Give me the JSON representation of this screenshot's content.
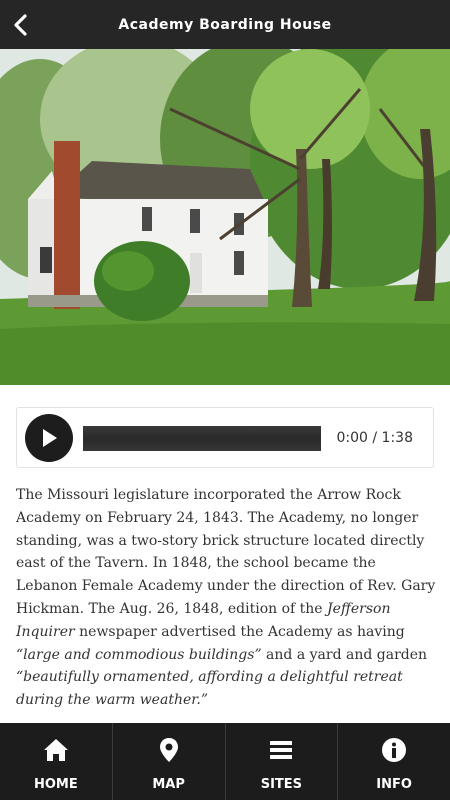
{
  "header": {
    "title": "Academy Boarding House",
    "back_icon": "chevron-left-icon"
  },
  "hero": {
    "description_icon": "photo"
  },
  "player": {
    "play_icon": "play-icon",
    "progress_fraction": 0,
    "current_time": "0:00",
    "separator": " / ",
    "duration": "1:38"
  },
  "article": {
    "p1": "The Missouri legislature incorporated the Arrow Rock Academy on February 24, 1843. The Academy, no longer standing, was a two-story brick structure located directly east of the Tavern. In 1848, the school became the Lebanon Female Academy under the direction of Rev. Gary Hickman. The Aug. 26, 1848, edition of the ",
    "p1_em": "Jefferson Inquirer",
    "p2": " newspaper advertised the Academy as having ",
    "p2_em": "“large and commodious buildings”",
    "p3": " and a yard and garden ",
    "p3_em": "“beautifully ornamented, affording a delightful retreat during the warm weather.”"
  },
  "nav": {
    "items": [
      {
        "label": "HOME",
        "icon": "home-icon"
      },
      {
        "label": "MAP",
        "icon": "map-pin-icon"
      },
      {
        "label": "SITES",
        "icon": "list-icon"
      },
      {
        "label": "INFO",
        "icon": "info-icon"
      }
    ]
  },
  "colors": {
    "header_bg": "#262626",
    "nav_bg": "#1c1c1c",
    "text": "#333333"
  }
}
